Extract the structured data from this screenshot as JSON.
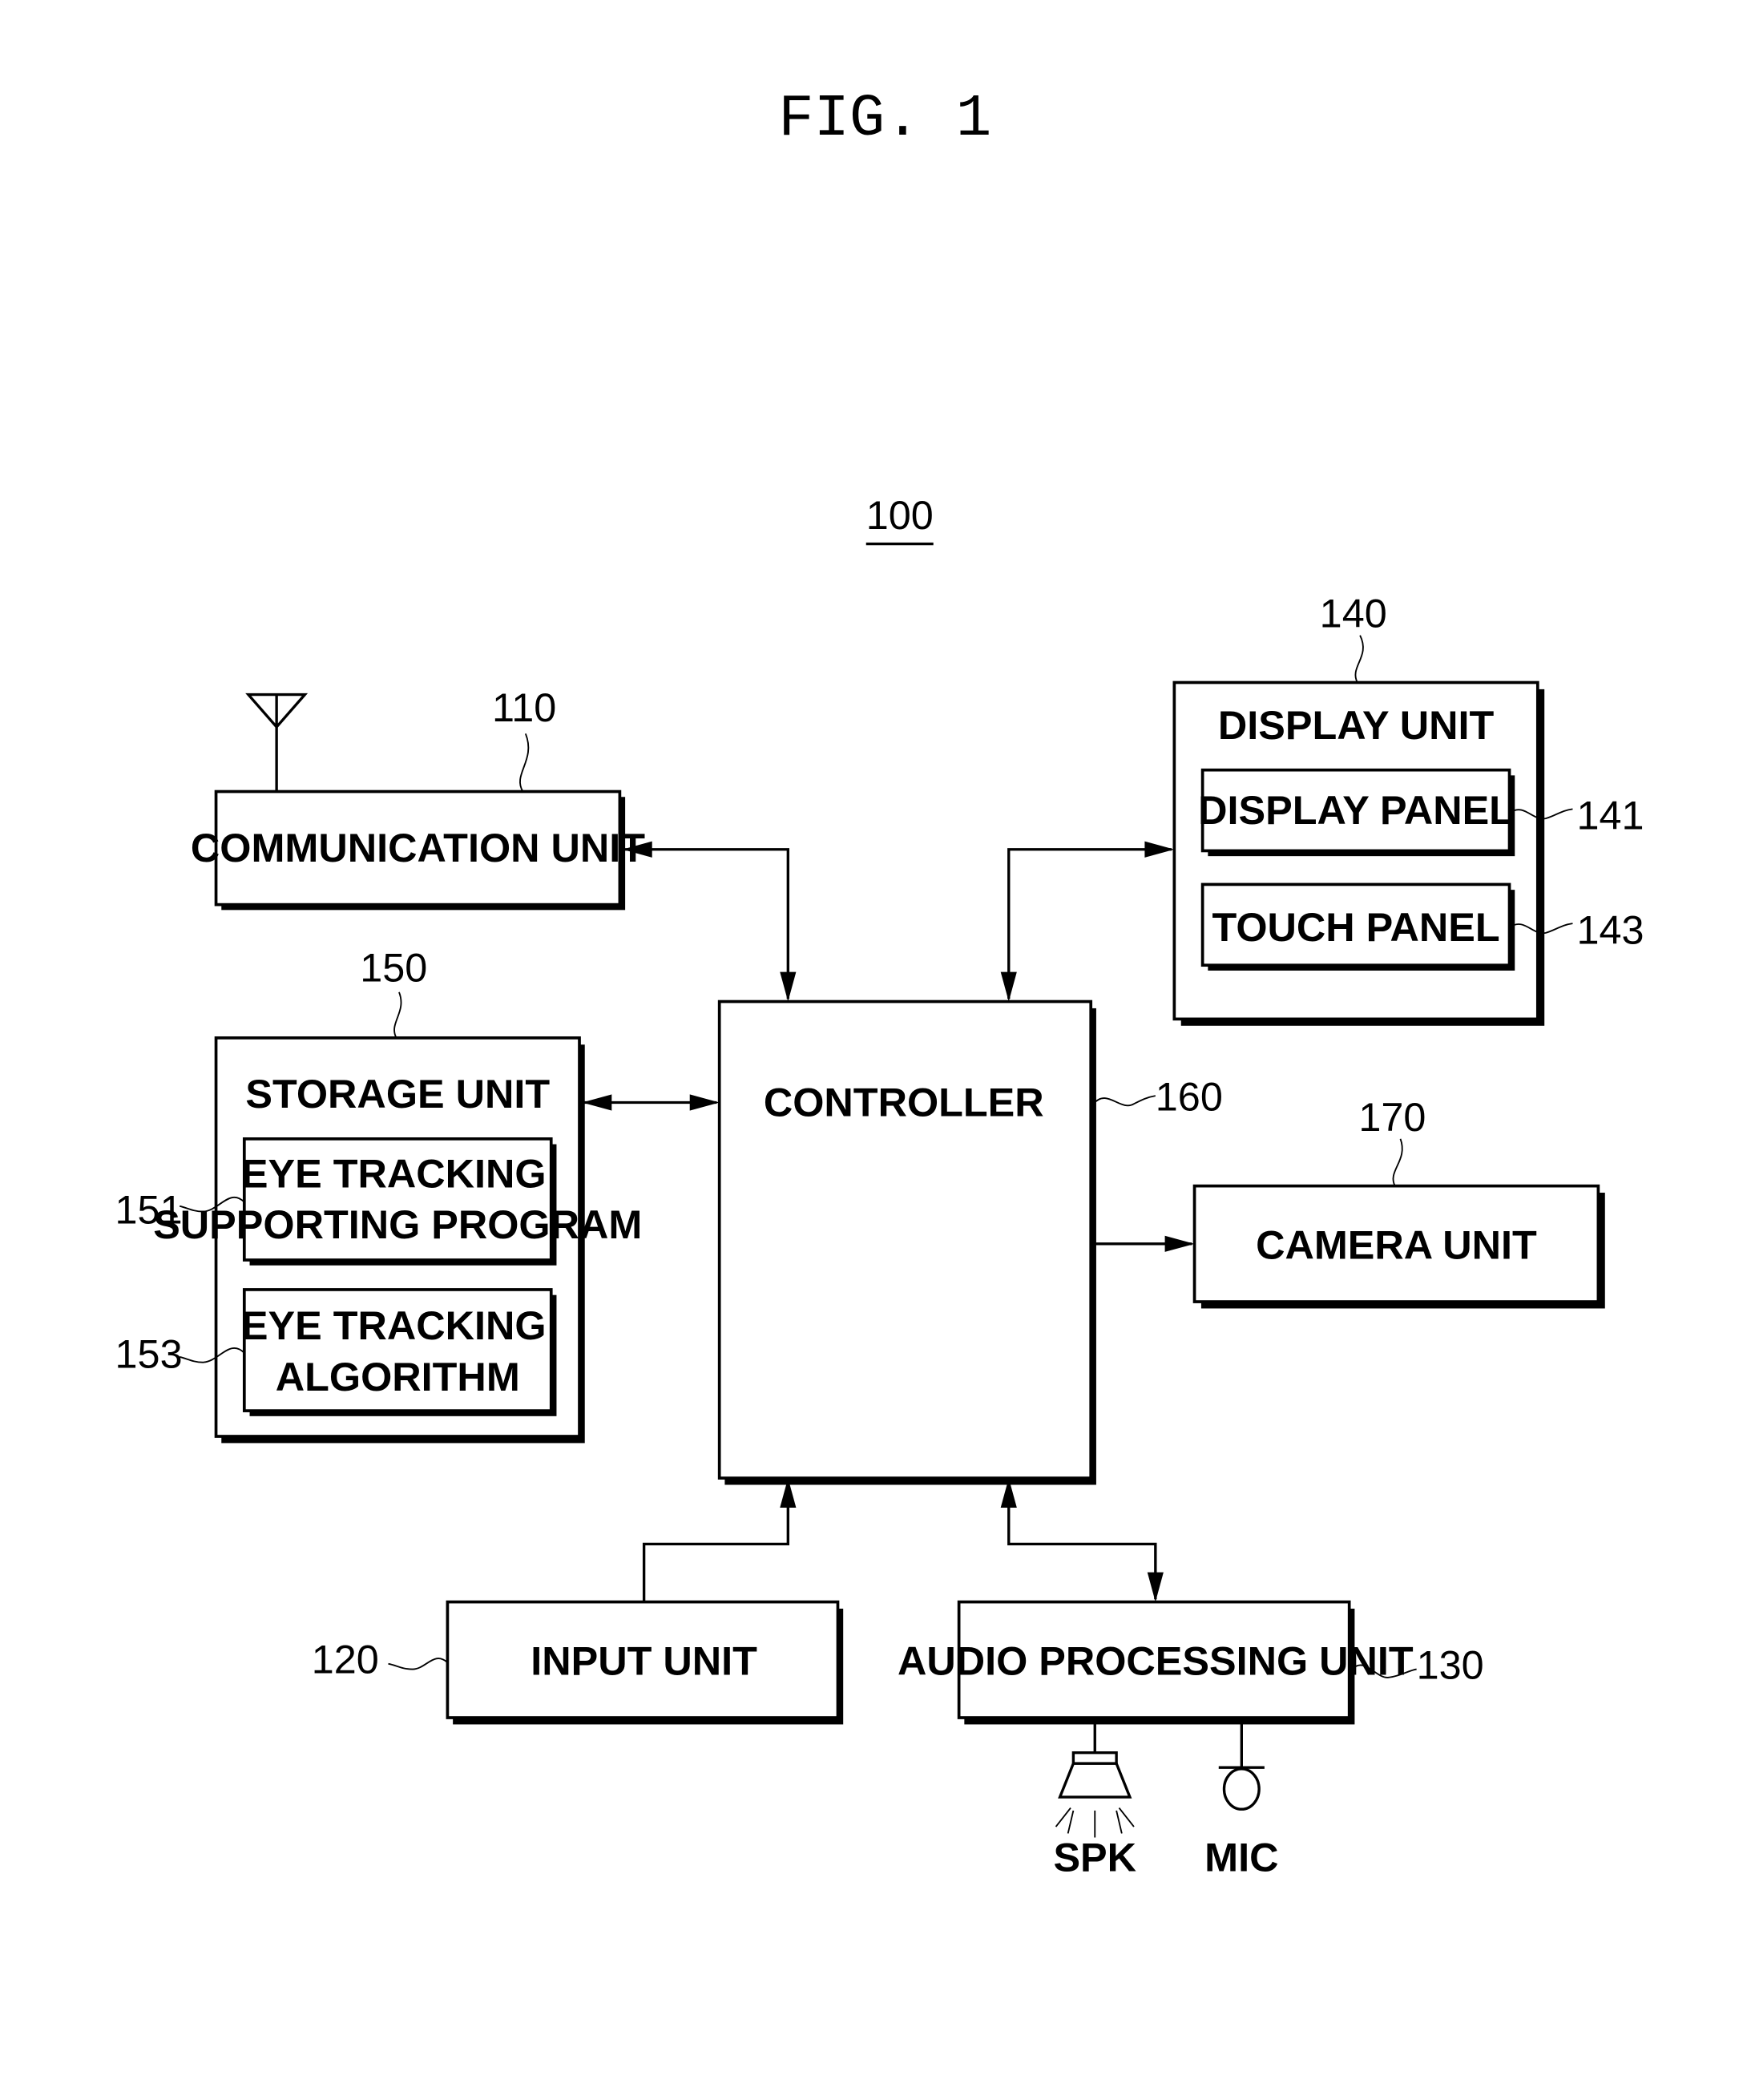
{
  "figure": {
    "title": "FIG. 1",
    "device_ref": "100"
  },
  "blocks": {
    "communication_unit": {
      "label": "COMMUNICATION UNIT",
      "ref": "110"
    },
    "input_unit": {
      "label": "INPUT UNIT",
      "ref": "120"
    },
    "audio_processing_unit": {
      "label": "AUDIO PROCESSING UNIT",
      "ref": "130"
    },
    "display_unit": {
      "label": "DISPLAY UNIT",
      "ref": "140"
    },
    "display_panel": {
      "label": "DISPLAY PANEL",
      "ref": "141"
    },
    "touch_panel": {
      "label": "TOUCH PANEL",
      "ref": "143"
    },
    "storage_unit": {
      "label": "STORAGE UNIT",
      "ref": "150"
    },
    "eye_tracking_program": {
      "label_line1": "EYE TRACKING",
      "label_line2": "SUPPORTING PROGRAM",
      "ref": "151"
    },
    "eye_tracking_algorithm": {
      "label_line1": "EYE TRACKING",
      "label_line2": "ALGORITHM",
      "ref": "153"
    },
    "controller": {
      "label": "CONTROLLER",
      "ref": "160"
    },
    "camera_unit": {
      "label": "CAMERA UNIT",
      "ref": "170"
    }
  },
  "peripherals": {
    "speaker": "SPK",
    "microphone": "MIC"
  },
  "connections": [
    {
      "from": "controller",
      "to": "communication_unit",
      "direction": "bidirectional"
    },
    {
      "from": "controller",
      "to": "display_unit",
      "direction": "bidirectional"
    },
    {
      "from": "controller",
      "to": "storage_unit",
      "direction": "bidirectional"
    },
    {
      "from": "controller",
      "to": "camera_unit",
      "direction": "to"
    },
    {
      "from": "input_unit",
      "to": "controller",
      "direction": "to"
    },
    {
      "from": "controller",
      "to": "audio_processing_unit",
      "direction": "bidirectional"
    }
  ]
}
